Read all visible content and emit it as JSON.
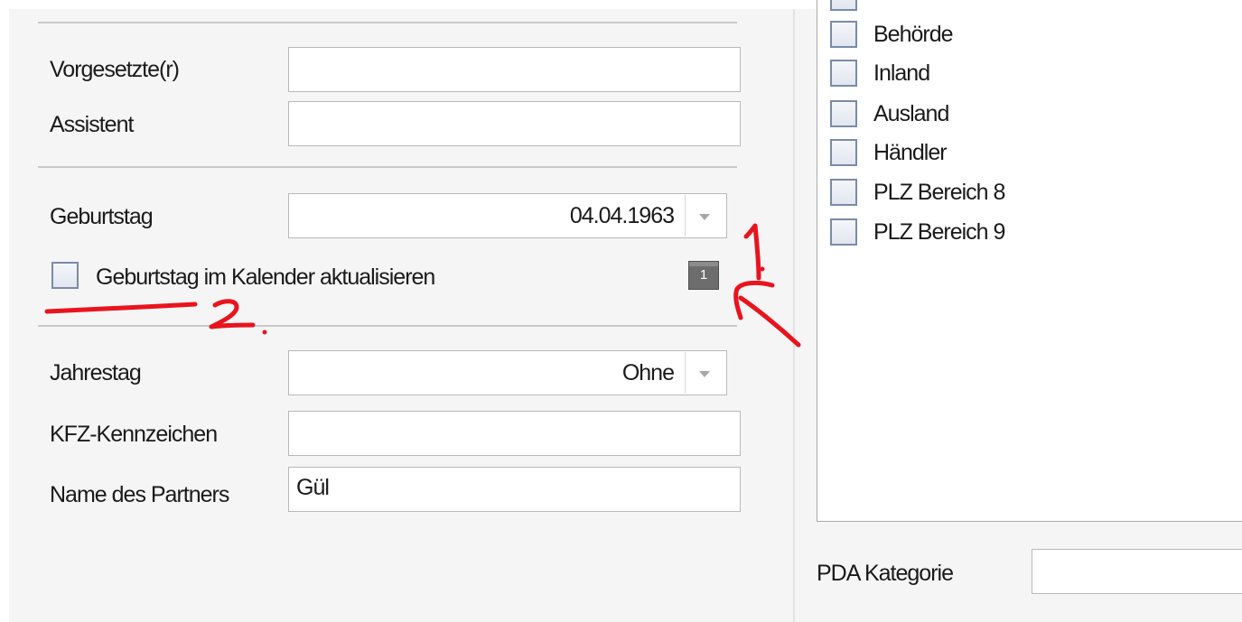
{
  "form": {
    "supervisor_label": "Vorgesetzte(r)",
    "supervisor_value": "",
    "assistant_label": "Assistent",
    "assistant_value": "",
    "birthday_label": "Geburtstag",
    "birthday_value": "04.04.1963",
    "birthday_calendar_checkbox_label": "Geburtstag im Kalender aktualisieren",
    "birthday_calendar_checked": false,
    "counter_badge": "1",
    "anniversary_label": "Jahrestag",
    "anniversary_value": "Ohne",
    "license_plate_label": "KFZ-Kennzeichen",
    "license_plate_value": "",
    "partner_name_label": "Name des Partners",
    "partner_name_value": "Gül"
  },
  "categories": {
    "items": [
      {
        "label": "Behörde",
        "checked": false
      },
      {
        "label": "Inland",
        "checked": false
      },
      {
        "label": "Ausland",
        "checked": false
      },
      {
        "label": "Händler",
        "checked": false
      },
      {
        "label": "PLZ Bereich 8",
        "checked": false
      },
      {
        "label": "PLZ Bereich 9",
        "checked": false
      }
    ],
    "pda_category_label": "PDA Kategorie",
    "pda_category_value": ""
  },
  "annotations": {
    "color": "#e8141e",
    "marks": [
      "1.",
      "2."
    ]
  }
}
